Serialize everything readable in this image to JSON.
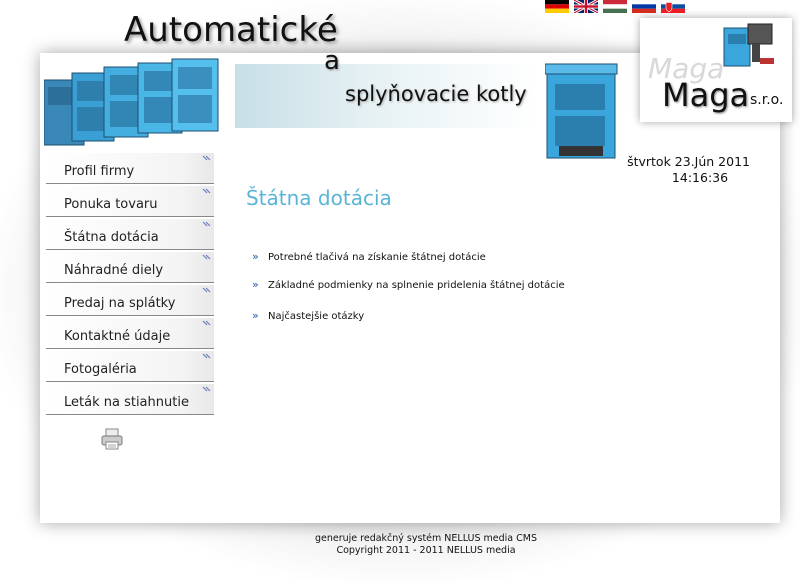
{
  "header": {
    "title_line1": "Automatické",
    "title_line2": "a",
    "title_line3": "splyňovacie kotly",
    "logo_ghost": "Maga",
    "logo_name": "Maga",
    "logo_suffix": "s.r.o."
  },
  "languages": [
    {
      "name": "german-flag-icon"
    },
    {
      "name": "uk-flag-icon"
    },
    {
      "name": "hungary-flag-icon"
    },
    {
      "name": "russia-flag-icon"
    },
    {
      "name": "slovakia-flag-icon"
    }
  ],
  "menu": {
    "items": [
      {
        "label": "Profil firmy"
      },
      {
        "label": "Ponuka tovaru"
      },
      {
        "label": "Štátna dotácia"
      },
      {
        "label": "Náhradné diely"
      },
      {
        "label": "Predaj na splátky"
      },
      {
        "label": "Kontaktné údaje"
      },
      {
        "label": "Fotogaléria"
      },
      {
        "label": "Leták na stiahnutie"
      }
    ]
  },
  "datetime": {
    "date": "štvrtok 23.Jún 2011",
    "time": "14:16:36"
  },
  "main": {
    "heading": "Štátna dotácia",
    "links": [
      {
        "label": "Potrebné tlačivá na získanie štátnej dotácie"
      },
      {
        "label": "Základné podmienky na splnenie pridelenia štátnej dotácie"
      },
      {
        "label": "Najčastejšie otázky"
      }
    ]
  },
  "footer": {
    "line1": "generuje redakčný systém NELLUS media CMS",
    "line2": "Copyright 2011 - 2011 NELLUS media"
  },
  "colors": {
    "heading_accent": "#5ab4d6",
    "boiler_blue": "#3aa6dc",
    "bullet_blue": "#2a55a8"
  }
}
